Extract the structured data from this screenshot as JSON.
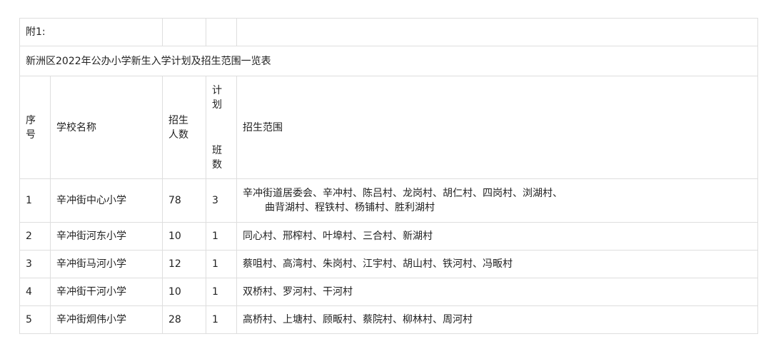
{
  "note": "附1:",
  "title": "新洲区2022年公办小学新生入学计划及招生范围一览表",
  "headers": {
    "seq": [
      "序",
      "号"
    ],
    "school_name": "学校名称",
    "enrollment": [
      "招生",
      "人数"
    ],
    "plan_classes_top": [
      "计",
      "划"
    ],
    "plan_classes_bottom": [
      "班",
      "数"
    ],
    "scope": "招生范围"
  },
  "rows": [
    {
      "seq": "1",
      "school": "辛冲街中心小学",
      "enrollment": "78",
      "classes": "3",
      "scope_line1": "辛冲街道居委会、辛冲村、陈吕村、龙岗村、胡仁村、四岗村、浏湖村、",
      "scope_line2": "曲背湖村、程铁村、杨铺村、胜利湖村"
    },
    {
      "seq": "2",
      "school": "辛冲街河东小学",
      "enrollment": "10",
      "classes": "1",
      "scope_line1": "同心村、邢榨村、叶埠村、三合村、新湖村"
    },
    {
      "seq": "3",
      "school": "辛冲街马河小学",
      "enrollment": "12",
      "classes": "1",
      "scope_line1": "蔡咀村、高湾村、朱岗村、江宇村、胡山村、铁河村、冯畈村"
    },
    {
      "seq": "4",
      "school": "辛冲街干河小学",
      "enrollment": "10",
      "classes": "1",
      "scope_line1": "双桥村、罗河村、干河村"
    },
    {
      "seq": "5",
      "school": "辛冲街炯伟小学",
      "enrollment": "28",
      "classes": "1",
      "scope_line1": "高桥村、上塘村、顾畈村、蔡院村、柳林村、周河村"
    }
  ]
}
